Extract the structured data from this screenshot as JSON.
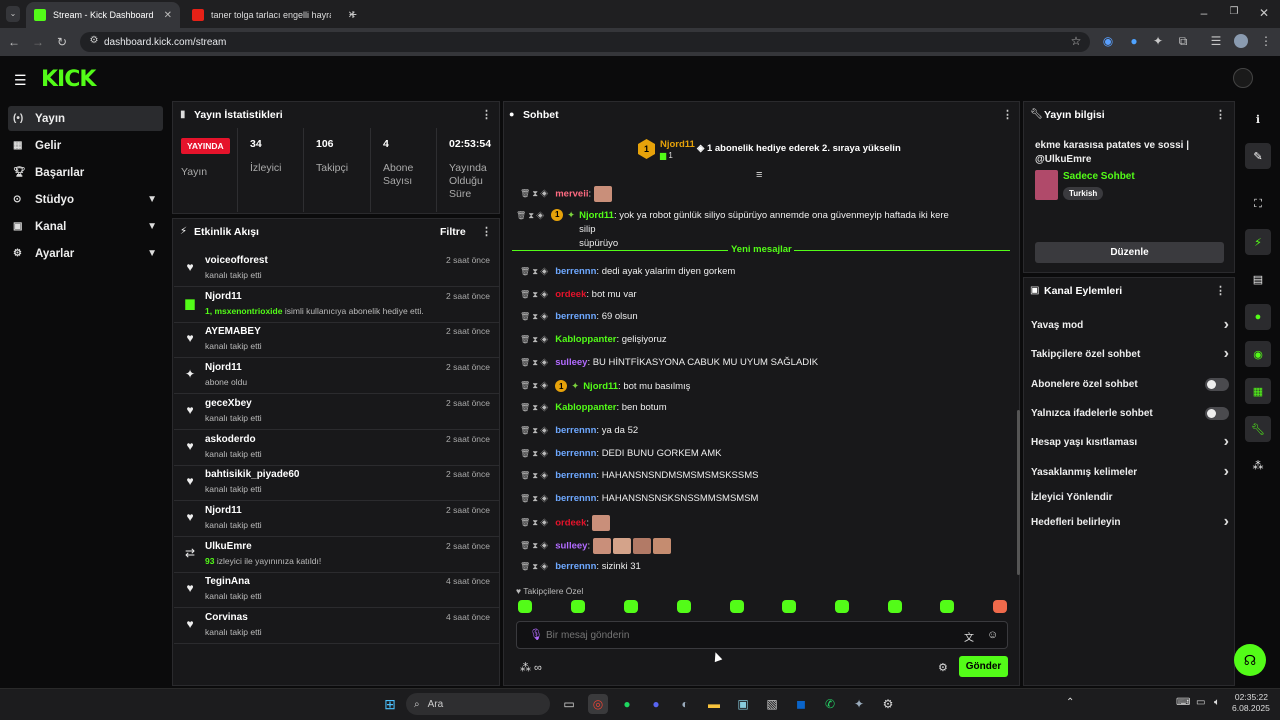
{
  "browser": {
    "tabs": [
      {
        "title": "Stream - Kick Dashboard",
        "active": true
      },
      {
        "title": "taner tolga tarlacı engelli hayra",
        "active": false
      }
    ],
    "url": "dashboard.kick.com/stream"
  },
  "sidebar": {
    "items": [
      {
        "label": "Yayın",
        "icon": "broadcast-icon"
      },
      {
        "label": "Gelir",
        "icon": "revenue-icon"
      },
      {
        "label": "Başarılar",
        "icon": "trophy-icon"
      },
      {
        "label": "Stüdyo",
        "icon": "studio-icon"
      },
      {
        "label": "Kanal",
        "icon": "channel-icon"
      },
      {
        "label": "Ayarlar",
        "icon": "gear-icon"
      }
    ]
  },
  "stats": {
    "title": "Yayın İstatistikleri",
    "live_badge": "YAYINDA",
    "live_label": "Yayın",
    "viewers_value": "34",
    "viewers_label": "İzleyici",
    "followers_value": "106",
    "followers_label": "Takipçi",
    "subs_value": "4",
    "subs_label": "Abone Sayısı",
    "uptime_value": "02:53:54",
    "uptime_label": "Yayında Olduğu Süre"
  },
  "activity": {
    "title": "Etkinlik Akışı",
    "filter": "Filtre",
    "items": [
      {
        "name": "voiceofforest",
        "desc": "kanalı takip etti",
        "time": "2 saat önce",
        "icon": "heart-icon"
      },
      {
        "name": "Njord11",
        "desc_highlight": "1, msxenontrioxide",
        "desc": " isimli kullanıcıya abonelik hediye etti.",
        "time": "2 saat önce",
        "icon": "gift-icon"
      },
      {
        "name": "AYEMABEY",
        "desc": "kanalı takip etti",
        "time": "2 saat önce",
        "icon": "heart-icon"
      },
      {
        "name": "Njord11",
        "desc": "abone oldu",
        "time": "2 saat önce",
        "icon": "sparkle-icon"
      },
      {
        "name": "geceXbey",
        "desc": "kanalı takip etti",
        "time": "2 saat önce",
        "icon": "heart-icon"
      },
      {
        "name": "askoderdo",
        "desc": "kanalı takip etti",
        "time": "2 saat önce",
        "icon": "heart-icon"
      },
      {
        "name": "bahtisikik_piyade60",
        "desc": "kanalı takip etti",
        "time": "2 saat önce",
        "icon": "heart-icon"
      },
      {
        "name": "Njord11",
        "desc": "kanalı takip etti",
        "time": "2 saat önce",
        "icon": "heart-icon"
      },
      {
        "name": "UlkuEmre",
        "desc_highlight": "93",
        "desc": " izleyici ile yayınınıza katıldı!",
        "time": "2 saat önce",
        "icon": "raid-icon"
      },
      {
        "name": "TeginAna",
        "desc": "kanalı takip etti",
        "time": "4 saat önce",
        "icon": "heart-icon"
      },
      {
        "name": "Corvinas",
        "desc": "kanalı takip etti",
        "time": "4 saat önce",
        "icon": "heart-icon"
      }
    ]
  },
  "chat": {
    "title": "Sohbet",
    "pinned_user": "Njord11",
    "pinned_count": "1",
    "pinned_text": "1 abonelik hediye ederek 2. sıraya yükselin",
    "new_messages": "Yeni mesajlar",
    "messages": [
      {
        "user": "merveii",
        "color": "#ff6b81",
        "text": "",
        "emotes": 1
      },
      {
        "user": "Njord11",
        "color": "#53fc18",
        "text": "yok ya robot günlük siliyo süpürüyo annemde ona güvenmeyip haftada iki kere silip",
        "text2": "süpürüyo",
        "badge": "1"
      },
      {
        "user": "berrennn",
        "color": "#6ea8ff",
        "text": "dedi ayak yalarim diyen gorkem"
      },
      {
        "user": "ordeek",
        "color": "#e5132b",
        "text": "bot mu var"
      },
      {
        "user": "berrennn",
        "color": "#6ea8ff",
        "text": "69 olsun"
      },
      {
        "user": "Kabloppanter",
        "color": "#53fc18",
        "text": "gelişiyoruz"
      },
      {
        "user": "sulleey",
        "color": "#b26bff",
        "text": "BU HİNTFİKASYONA CABUK MU UYUM SAĞLADIK"
      },
      {
        "user": "Njord11",
        "color": "#53fc18",
        "text": "bot mu basılmış",
        "badge": "1"
      },
      {
        "user": "Kabloppanter",
        "color": "#53fc18",
        "text": "ben botum"
      },
      {
        "user": "berrennn",
        "color": "#6ea8ff",
        "text": "ya da 52"
      },
      {
        "user": "berrennn",
        "color": "#6ea8ff",
        "text": "DEDI BUNU GORKEM AMK"
      },
      {
        "user": "berrennn",
        "color": "#6ea8ff",
        "text": "HAHANSNSNDMSMSMSMSKSSMS"
      },
      {
        "user": "berrennn",
        "color": "#6ea8ff",
        "text": "HAHANSNSNSKSNSSMMSMSMSM"
      },
      {
        "user": "ordeek",
        "color": "#e5132b",
        "text": "",
        "emotes": 1
      },
      {
        "user": "sulleey",
        "color": "#b26bff",
        "text": "",
        "emotes": 4
      },
      {
        "user": "berrennn",
        "color": "#6ea8ff",
        "text": "sizinki 31"
      }
    ],
    "followers_only": "Takipçilere Özel",
    "input_placeholder": "Bir mesaj gönderin",
    "send": "Gönder"
  },
  "stream_info": {
    "title": "Yayın bilgisi",
    "stream_title": "ekme karasısa patates ve sossi | @UlkuEmre",
    "category": "Sadece Sohbet",
    "tag": "Turkish",
    "edit": "Düzenle"
  },
  "channel_actions": {
    "title": "Kanal Eylemleri",
    "items": [
      {
        "label": "Yavaş mod",
        "type": "chevron"
      },
      {
        "label": "Takipçilere özel sohbet",
        "type": "chevron"
      },
      {
        "label": "Abonelere özel sohbet",
        "type": "toggle"
      },
      {
        "label": "Yalnızca ifadelerle sohbet",
        "type": "toggle"
      },
      {
        "label": "Hesap yaşı kısıtlaması",
        "type": "chevron"
      },
      {
        "label": "Yasaklanmış kelimeler",
        "type": "chevron"
      },
      {
        "label": "İzleyici Yönlendir",
        "type": "none"
      },
      {
        "label": "Hedefleri belirleyin",
        "type": "chevron"
      }
    ]
  },
  "taskbar": {
    "search": "Ara",
    "time": "02:35:22",
    "date": "6.08.2025"
  },
  "colors": {
    "accent": "#53fc18",
    "live": "#e5132b",
    "panel": "#18181a",
    "bg": "#0b0b0c"
  }
}
